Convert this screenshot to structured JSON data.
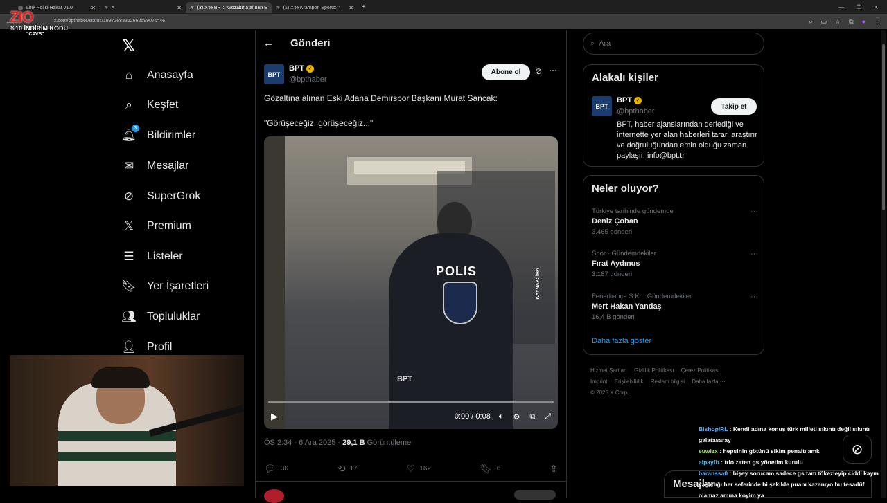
{
  "browser": {
    "tabs": [
      {
        "label": "Link Polisi Hakat v1.0"
      },
      {
        "label": "X"
      },
      {
        "label": "(3) X'te BPT: \"Gözaltına alınan E"
      },
      {
        "label": "(1) X'te Krampon Sports: \""
      }
    ],
    "url": "x.com/bpthaber/status/1997268335266859907s=46"
  },
  "overlay_logo": {
    "brand": "ZIO",
    "promo": "%10 İNDİRİM KODU",
    "code": "\"CAVS\""
  },
  "nav": {
    "items": [
      {
        "label": "Anasayfa",
        "icon": "home-icon"
      },
      {
        "label": "Keşfet",
        "icon": "search-icon"
      },
      {
        "label": "Bildirimler",
        "icon": "bell-icon",
        "badge": "3"
      },
      {
        "label": "Mesajlar",
        "icon": "mail-icon"
      },
      {
        "label": "SuperGrok",
        "icon": "grok-icon"
      },
      {
        "label": "Premium",
        "icon": "x-icon"
      },
      {
        "label": "Listeler",
        "icon": "list-icon"
      },
      {
        "label": "Yer İşaretleri",
        "icon": "bookmark-icon"
      },
      {
        "label": "Topluluklar",
        "icon": "communities-icon"
      },
      {
        "label": "Profil",
        "icon": "profile-icon"
      }
    ]
  },
  "post": {
    "header": "Gönderi",
    "author_name": "BPT",
    "author_handle": "@bpthaber",
    "avatar_text": "BPT",
    "subscribe_label": "Abone ol",
    "text_line1": "Gözaltına alınan Eski Adana Demirspor Başkanı Murat Sancak:",
    "text_line2": "\"Görüşeceğiz, görüşeceğiz...\"",
    "video": {
      "polis_text": "POLIS",
      "source_text": "KAYNAK: İHA",
      "watermark": "BPT",
      "time": "0:00 / 0:08",
      "progress": 0.0
    },
    "time": "ÖS 2:34 · 6 Ara 2025 · ",
    "views": "29,1 B",
    "views_label": " Görüntüleme",
    "replies": "36",
    "reposts": "17",
    "likes": "162",
    "bookmarks": "6"
  },
  "search": {
    "placeholder": "Ara"
  },
  "related": {
    "title": "Alakalı kişiler",
    "name": "BPT",
    "handle": "@bpthaber",
    "follow_label": "Takip et",
    "bio": "BPT, haber ajanslarından derlediği ve internette yer alan haberleri tarar, araştırır ve doğruluğundan emin olduğu zaman paylaşır. info@bpt.tr"
  },
  "trends": {
    "title": "Neler oluyor?",
    "items": [
      {
        "category": "Türkiye tarihinde gündemde",
        "title": "Deniz Çoban",
        "count": "3.465 gönderi"
      },
      {
        "category": "Spor · Gündemdekiler",
        "title": "Fırat Aydınus",
        "count": "3.187 gönderi"
      },
      {
        "category": "Fenerbahçe S.K. · Gündemdekiler",
        "title": "Mert Hakan Yandaş",
        "count": "16,4 B gönderi"
      }
    ],
    "more_label": "Daha fazla göster"
  },
  "footer": {
    "links": [
      "Hizmet Şartları",
      "Gizlilik Politikası",
      "Çerez Politikası",
      "Imprint",
      "Erişilebilirlik",
      "Reklam bilgisi",
      "Daha fazla ···"
    ],
    "copyright": "© 2025 X Corp."
  },
  "chat": [
    {
      "user": "BishopIRL",
      "msg": "Kendi adına konuş türk milleti sıkıntı değil sıkıntı galatasaray"
    },
    {
      "user": "euwizx",
      "msg": "hepsinin götünü sikim penaltı amk"
    },
    {
      "user": "alpayfb",
      "msg": "trio zaten gs yönetim kurulu"
    },
    {
      "user": "baranssa0",
      "msg": "bişey sorucam sadece gs tam tökezleyip ciddi kayın yaşadığı her seferinde bi şekilde puanı kazanıyo bu tesadüf olamaz amına koyim ya"
    }
  ],
  "messages_bar": {
    "label": "Mesajlar"
  }
}
